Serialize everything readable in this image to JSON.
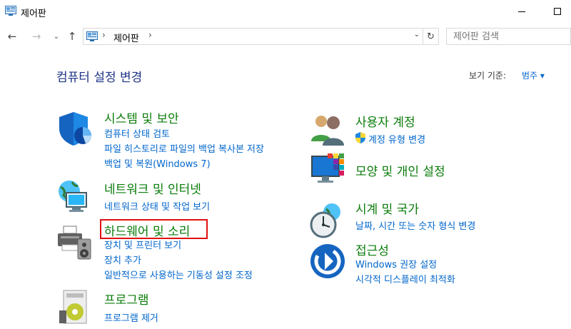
{
  "window": {
    "title": "제어판"
  },
  "nav": {
    "back_icon": "←",
    "forward_icon": "→",
    "recent_icon": "⌄",
    "up_icon": "↑"
  },
  "address": {
    "separator": "›",
    "crumb": "제어판",
    "dropdown_icon": "⌄",
    "refresh_icon": "↻"
  },
  "search": {
    "placeholder": "제어판 검색"
  },
  "header": {
    "title": "컴퓨터 설정 변경",
    "viewby_label": "보기 기준:",
    "viewby_value": "범주 ▾"
  },
  "categories": [
    {
      "title": "시스템 및 보안",
      "links": [
        "컴퓨터 상태 검토",
        "파일 히스토리로 파일의 백업 복사본 저장",
        "백업 및 복원(Windows 7)"
      ]
    },
    {
      "title": "네트워크 및 인터넷",
      "links": [
        "네트워크 상태 및 작업 보기"
      ]
    },
    {
      "title": "하드웨어 및 소리",
      "links": [
        "장치 및 프린터 보기",
        "장치 추가",
        "일반적으로 사용하는 기동성 설정 조정"
      ]
    },
    {
      "title": "프로그램",
      "links": [
        "프로그램 제거"
      ]
    },
    {
      "title": "사용자 계정",
      "links": [
        "계정 유형 변경"
      ]
    },
    {
      "title": "모양 및 개인 설정",
      "links": []
    },
    {
      "title": "시계 및 국가",
      "links": [
        "날짜, 시간 또는 숫자 형식 변경"
      ]
    },
    {
      "title": "접근성",
      "links": [
        "Windows 권장 설정",
        "시각적 디스플레이 최적화"
      ]
    }
  ],
  "colors": {
    "category_title": "#0a7c0a",
    "link": "#0066cc",
    "page_title": "#1e3287",
    "highlight": "#e01010"
  }
}
